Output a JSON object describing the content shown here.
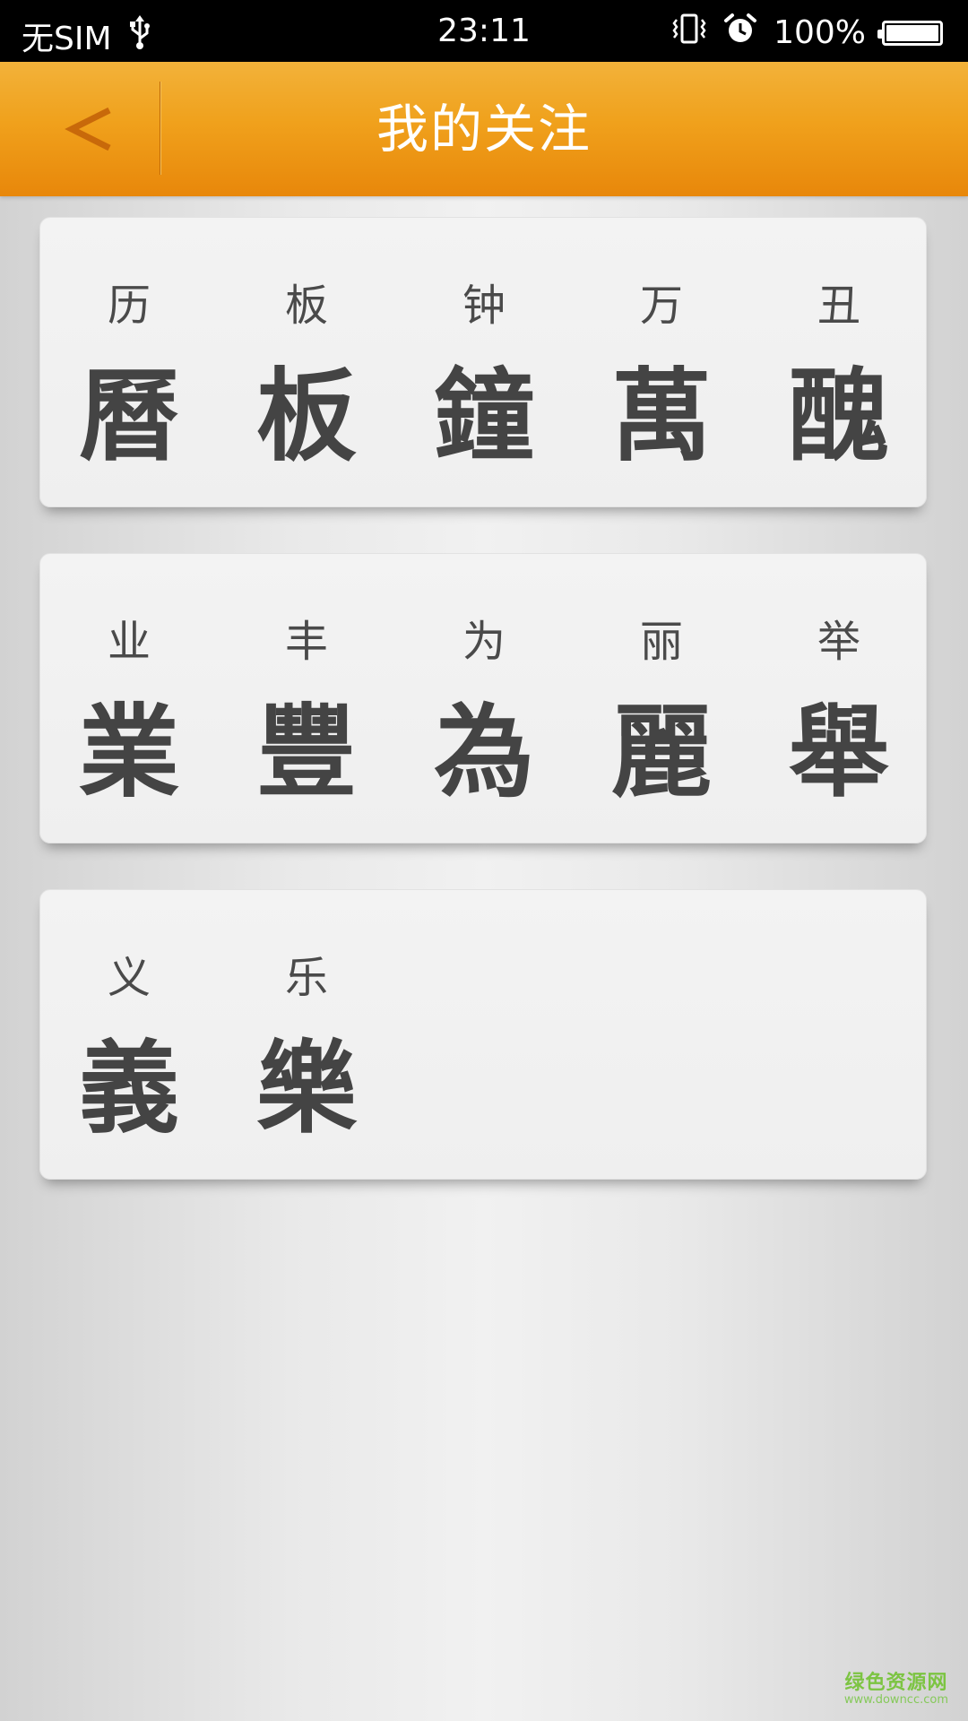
{
  "status_bar": {
    "carrier": "无SIM",
    "time": "23:11",
    "battery": "100%",
    "battery_level": 1.0,
    "icons": [
      "usb-icon",
      "vibrate-icon",
      "alarm-icon",
      "battery-icon"
    ]
  },
  "header": {
    "title": "我的关注",
    "back_icon": "chevron-left-icon",
    "colors": {
      "bar_top": "#f2b23a",
      "bar_bottom": "#e8870a",
      "back_icon": "#c8690a",
      "title": "#ffffff"
    }
  },
  "cards": [
    {
      "chars": [
        {
          "simplified": "历",
          "traditional": "曆"
        },
        {
          "simplified": "板",
          "traditional": "板"
        },
        {
          "simplified": "钟",
          "traditional": "鐘"
        },
        {
          "simplified": "万",
          "traditional": "萬"
        },
        {
          "simplified": "丑",
          "traditional": "醜"
        }
      ]
    },
    {
      "chars": [
        {
          "simplified": "业",
          "traditional": "業"
        },
        {
          "simplified": "丰",
          "traditional": "豐"
        },
        {
          "simplified": "为",
          "traditional": "為"
        },
        {
          "simplified": "丽",
          "traditional": "麗"
        },
        {
          "simplified": "举",
          "traditional": "舉"
        }
      ]
    },
    {
      "chars": [
        {
          "simplified": "义",
          "traditional": "義"
        },
        {
          "simplified": "乐",
          "traditional": "樂"
        }
      ]
    }
  ],
  "watermark": {
    "main": "绿色资源网",
    "sub": "www.downcc.com"
  }
}
